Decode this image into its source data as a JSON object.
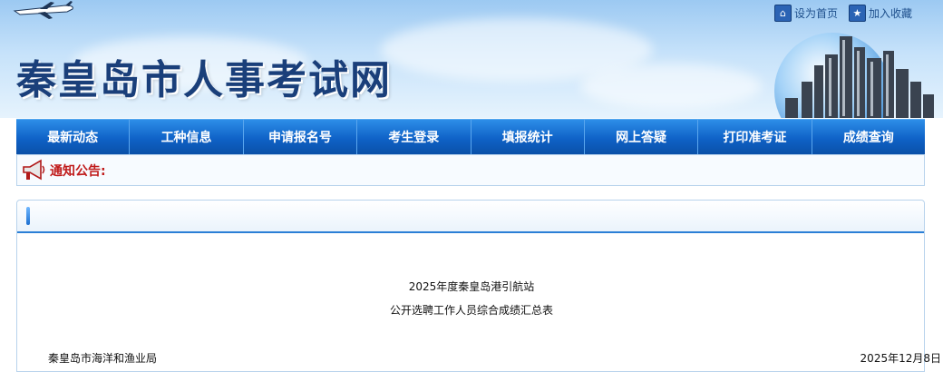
{
  "header": {
    "site_title": "秦皇岛市人事考试网",
    "top_links": [
      {
        "label": "设为首页",
        "icon": "home-icon"
      },
      {
        "label": "加入收藏",
        "icon": "star-icon"
      }
    ]
  },
  "nav": {
    "items": [
      "最新动态",
      "工种信息",
      "申请报名号",
      "考生登录",
      "填报统计",
      "网上答疑",
      "打印准考证",
      "成绩查询"
    ]
  },
  "notice": {
    "label": "通知公告:",
    "icon": "megaphone-icon"
  },
  "article": {
    "title_line1": "2025年度秦皇岛港引航站",
    "title_line2": "公开选聘工作人员综合成绩汇总表",
    "org": "秦皇岛市海洋和渔业局",
    "date": "2025年12月8日"
  },
  "colors": {
    "nav_blue": "#0f62c7",
    "title_blue": "#1a3f7a",
    "notice_red": "#c01b1b"
  }
}
